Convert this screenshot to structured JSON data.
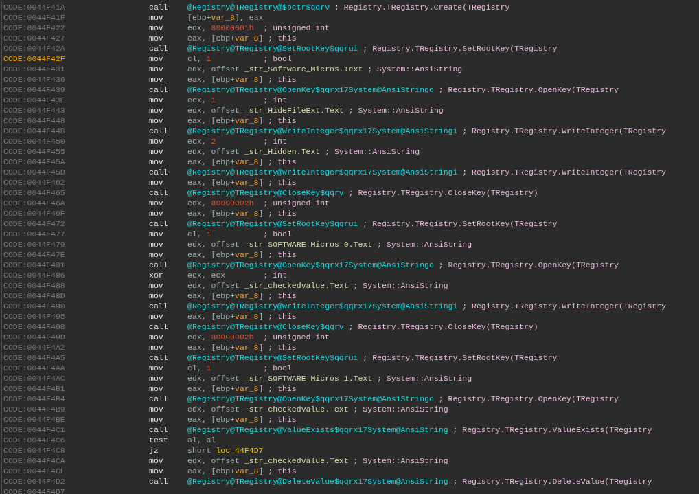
{
  "listing": [
    {
      "address": "CODE:0044F41A",
      "selected": false,
      "mnemonic": "call",
      "operands": [
        {
          "kind": "sym",
          "text": "@Registry@TRegistry@$bctr$qqrv"
        }
      ],
      "comment": "; Registry.TRegistry.Create(TRegistry"
    },
    {
      "address": "CODE:0044F41F",
      "selected": false,
      "mnemonic": "mov",
      "operands": [
        {
          "kind": "plain",
          "text": "[ebp+"
        },
        {
          "kind": "var",
          "text": "var_8"
        },
        {
          "kind": "plain",
          "text": "], eax"
        }
      ]
    },
    {
      "address": "CODE:0044F422",
      "selected": false,
      "mnemonic": "mov",
      "operands": [
        {
          "kind": "plain",
          "text": "edx, "
        },
        {
          "kind": "num",
          "text": "80000001h"
        }
      ],
      "comment": "; unsigned int"
    },
    {
      "address": "CODE:0044F427",
      "selected": false,
      "mnemonic": "mov",
      "operands": [
        {
          "kind": "plain",
          "text": "eax, [ebp+"
        },
        {
          "kind": "var",
          "text": "var_8"
        },
        {
          "kind": "plain",
          "text": "]"
        }
      ],
      "comment": "; this"
    },
    {
      "address": "CODE:0044F42A",
      "selected": false,
      "mnemonic": "call",
      "operands": [
        {
          "kind": "sym",
          "text": "@Registry@TRegistry@SetRootKey$qqrui"
        }
      ],
      "comment": "; Registry.TRegistry.SetRootKey(TRegistry"
    },
    {
      "address": "CODE:0044F42F",
      "selected": true,
      "mnemonic": "mov",
      "operands": [
        {
          "kind": "plain",
          "text": "cl, "
        },
        {
          "kind": "num",
          "text": "1"
        }
      ],
      "comment": "; bool"
    },
    {
      "address": "CODE:0044F431",
      "selected": false,
      "mnemonic": "mov",
      "operands": [
        {
          "kind": "plain",
          "text": "edx, offset "
        },
        {
          "kind": "str",
          "text": "_str_Software_Micros.Text"
        }
      ],
      "comment": "; System::AnsiString"
    },
    {
      "address": "CODE:0044F436",
      "selected": false,
      "mnemonic": "mov",
      "operands": [
        {
          "kind": "plain",
          "text": "eax, [ebp+"
        },
        {
          "kind": "var",
          "text": "var_8"
        },
        {
          "kind": "plain",
          "text": "]"
        }
      ],
      "comment": "; this"
    },
    {
      "address": "CODE:0044F439",
      "selected": false,
      "mnemonic": "call",
      "operands": [
        {
          "kind": "sym",
          "text": "@Registry@TRegistry@OpenKey$qqrx17System@AnsiStringo"
        }
      ],
      "comment": "; Registry.TRegistry.OpenKey(TRegistry"
    },
    {
      "address": "CODE:0044F43E",
      "selected": false,
      "mnemonic": "mov",
      "operands": [
        {
          "kind": "plain",
          "text": "ecx, "
        },
        {
          "kind": "num",
          "text": "1"
        }
      ],
      "comment": "; int"
    },
    {
      "address": "CODE:0044F443",
      "selected": false,
      "mnemonic": "mov",
      "operands": [
        {
          "kind": "plain",
          "text": "edx, offset "
        },
        {
          "kind": "str",
          "text": "_str_HideFileExt.Text"
        }
      ],
      "comment": "; System::AnsiString"
    },
    {
      "address": "CODE:0044F448",
      "selected": false,
      "mnemonic": "mov",
      "operands": [
        {
          "kind": "plain",
          "text": "eax, [ebp+"
        },
        {
          "kind": "var",
          "text": "var_8"
        },
        {
          "kind": "plain",
          "text": "]"
        }
      ],
      "comment": "; this"
    },
    {
      "address": "CODE:0044F44B",
      "selected": false,
      "mnemonic": "call",
      "operands": [
        {
          "kind": "sym",
          "text": "@Registry@TRegistry@WriteInteger$qqrx17System@AnsiStringi"
        }
      ],
      "comment": "; Registry.TRegistry.WriteInteger(TRegistry"
    },
    {
      "address": "CODE:0044F450",
      "selected": false,
      "mnemonic": "mov",
      "operands": [
        {
          "kind": "plain",
          "text": "ecx, "
        },
        {
          "kind": "num",
          "text": "2"
        }
      ],
      "comment": "; int"
    },
    {
      "address": "CODE:0044F455",
      "selected": false,
      "mnemonic": "mov",
      "operands": [
        {
          "kind": "plain",
          "text": "edx, offset "
        },
        {
          "kind": "str",
          "text": "_str_Hidden.Text"
        }
      ],
      "comment": "; System::AnsiString"
    },
    {
      "address": "CODE:0044F45A",
      "selected": false,
      "mnemonic": "mov",
      "operands": [
        {
          "kind": "plain",
          "text": "eax, [ebp+"
        },
        {
          "kind": "var",
          "text": "var_8"
        },
        {
          "kind": "plain",
          "text": "]"
        }
      ],
      "comment": "; this"
    },
    {
      "address": "CODE:0044F45D",
      "selected": false,
      "mnemonic": "call",
      "operands": [
        {
          "kind": "sym",
          "text": "@Registry@TRegistry@WriteInteger$qqrx17System@AnsiStringi"
        }
      ],
      "comment": "; Registry.TRegistry.WriteInteger(TRegistry"
    },
    {
      "address": "CODE:0044F462",
      "selected": false,
      "mnemonic": "mov",
      "operands": [
        {
          "kind": "plain",
          "text": "eax, [ebp+"
        },
        {
          "kind": "var",
          "text": "var_8"
        },
        {
          "kind": "plain",
          "text": "]"
        }
      ],
      "comment": "; this"
    },
    {
      "address": "CODE:0044F465",
      "selected": false,
      "mnemonic": "call",
      "operands": [
        {
          "kind": "sym",
          "text": "@Registry@TRegistry@CloseKey$qqrv"
        }
      ],
      "comment": "; Registry.TRegistry.CloseKey(TRegistry)"
    },
    {
      "address": "CODE:0044F46A",
      "selected": false,
      "mnemonic": "mov",
      "operands": [
        {
          "kind": "plain",
          "text": "edx, "
        },
        {
          "kind": "num",
          "text": "80000002h"
        }
      ],
      "comment": "; unsigned int"
    },
    {
      "address": "CODE:0044F46F",
      "selected": false,
      "mnemonic": "mov",
      "operands": [
        {
          "kind": "plain",
          "text": "eax, [ebp+"
        },
        {
          "kind": "var",
          "text": "var_8"
        },
        {
          "kind": "plain",
          "text": "]"
        }
      ],
      "comment": "; this"
    },
    {
      "address": "CODE:0044F472",
      "selected": false,
      "mnemonic": "call",
      "operands": [
        {
          "kind": "sym",
          "text": "@Registry@TRegistry@SetRootKey$qqrui"
        }
      ],
      "comment": "; Registry.TRegistry.SetRootKey(TRegistry"
    },
    {
      "address": "CODE:0044F477",
      "selected": false,
      "mnemonic": "mov",
      "operands": [
        {
          "kind": "plain",
          "text": "cl, "
        },
        {
          "kind": "num",
          "text": "1"
        }
      ],
      "comment": "; bool"
    },
    {
      "address": "CODE:0044F479",
      "selected": false,
      "mnemonic": "mov",
      "operands": [
        {
          "kind": "plain",
          "text": "edx, offset "
        },
        {
          "kind": "str",
          "text": "_str_SOFTWARE_Micros_0.Text"
        }
      ],
      "comment": "; System::AnsiString"
    },
    {
      "address": "CODE:0044F47E",
      "selected": false,
      "mnemonic": "mov",
      "operands": [
        {
          "kind": "plain",
          "text": "eax, [ebp+"
        },
        {
          "kind": "var",
          "text": "var_8"
        },
        {
          "kind": "plain",
          "text": "]"
        }
      ],
      "comment": "; this"
    },
    {
      "address": "CODE:0044F481",
      "selected": false,
      "mnemonic": "call",
      "operands": [
        {
          "kind": "sym",
          "text": "@Registry@TRegistry@OpenKey$qqrx17System@AnsiStringo"
        }
      ],
      "comment": "; Registry.TRegistry.OpenKey(TRegistry"
    },
    {
      "address": "CODE:0044F486",
      "selected": false,
      "mnemonic": "xor",
      "operands": [
        {
          "kind": "plain",
          "text": "ecx, ecx"
        }
      ],
      "comment": "; int"
    },
    {
      "address": "CODE:0044F488",
      "selected": false,
      "mnemonic": "mov",
      "operands": [
        {
          "kind": "plain",
          "text": "edx, offset "
        },
        {
          "kind": "str",
          "text": "_str_checkedvalue.Text"
        }
      ],
      "comment": "; System::AnsiString"
    },
    {
      "address": "CODE:0044F48D",
      "selected": false,
      "mnemonic": "mov",
      "operands": [
        {
          "kind": "plain",
          "text": "eax, [ebp+"
        },
        {
          "kind": "var",
          "text": "var_8"
        },
        {
          "kind": "plain",
          "text": "]"
        }
      ],
      "comment": "; this"
    },
    {
      "address": "CODE:0044F490",
      "selected": false,
      "mnemonic": "call",
      "operands": [
        {
          "kind": "sym",
          "text": "@Registry@TRegistry@WriteInteger$qqrx17System@AnsiStringi"
        }
      ],
      "comment": "; Registry.TRegistry.WriteInteger(TRegistry"
    },
    {
      "address": "CODE:0044F495",
      "selected": false,
      "mnemonic": "mov",
      "operands": [
        {
          "kind": "plain",
          "text": "eax, [ebp+"
        },
        {
          "kind": "var",
          "text": "var_8"
        },
        {
          "kind": "plain",
          "text": "]"
        }
      ],
      "comment": "; this"
    },
    {
      "address": "CODE:0044F498",
      "selected": false,
      "mnemonic": "call",
      "operands": [
        {
          "kind": "sym",
          "text": "@Registry@TRegistry@CloseKey$qqrv"
        }
      ],
      "comment": "; Registry.TRegistry.CloseKey(TRegistry)"
    },
    {
      "address": "CODE:0044F49D",
      "selected": false,
      "mnemonic": "mov",
      "operands": [
        {
          "kind": "plain",
          "text": "edx, "
        },
        {
          "kind": "num",
          "text": "80000002h"
        }
      ],
      "comment": "; unsigned int"
    },
    {
      "address": "CODE:0044F4A2",
      "selected": false,
      "mnemonic": "mov",
      "operands": [
        {
          "kind": "plain",
          "text": "eax, [ebp+"
        },
        {
          "kind": "var",
          "text": "var_8"
        },
        {
          "kind": "plain",
          "text": "]"
        }
      ],
      "comment": "; this"
    },
    {
      "address": "CODE:0044F4A5",
      "selected": false,
      "mnemonic": "call",
      "operands": [
        {
          "kind": "sym",
          "text": "@Registry@TRegistry@SetRootKey$qqrui"
        }
      ],
      "comment": "; Registry.TRegistry.SetRootKey(TRegistry"
    },
    {
      "address": "CODE:0044F4AA",
      "selected": false,
      "mnemonic": "mov",
      "operands": [
        {
          "kind": "plain",
          "text": "cl, "
        },
        {
          "kind": "num",
          "text": "1"
        }
      ],
      "comment": "; bool"
    },
    {
      "address": "CODE:0044F4AC",
      "selected": false,
      "mnemonic": "mov",
      "operands": [
        {
          "kind": "plain",
          "text": "edx, offset "
        },
        {
          "kind": "str",
          "text": "_str_SOFTWARE_Micros_1.Text"
        }
      ],
      "comment": "; System::AnsiString"
    },
    {
      "address": "CODE:0044F4B1",
      "selected": false,
      "mnemonic": "mov",
      "operands": [
        {
          "kind": "plain",
          "text": "eax, [ebp+"
        },
        {
          "kind": "var",
          "text": "var_8"
        },
        {
          "kind": "plain",
          "text": "]"
        }
      ],
      "comment": "; this"
    },
    {
      "address": "CODE:0044F4B4",
      "selected": false,
      "mnemonic": "call",
      "operands": [
        {
          "kind": "sym",
          "text": "@Registry@TRegistry@OpenKey$qqrx17System@AnsiStringo"
        }
      ],
      "comment": "; Registry.TRegistry.OpenKey(TRegistry"
    },
    {
      "address": "CODE:0044F4B9",
      "selected": false,
      "mnemonic": "mov",
      "operands": [
        {
          "kind": "plain",
          "text": "edx, offset "
        },
        {
          "kind": "str",
          "text": "_str_checkedvalue.Text"
        }
      ],
      "comment": "; System::AnsiString"
    },
    {
      "address": "CODE:0044F4BE",
      "selected": false,
      "mnemonic": "mov",
      "operands": [
        {
          "kind": "plain",
          "text": "eax, [ebp+"
        },
        {
          "kind": "var",
          "text": "var_8"
        },
        {
          "kind": "plain",
          "text": "]"
        }
      ],
      "comment": "; this"
    },
    {
      "address": "CODE:0044F4C1",
      "selected": false,
      "mnemonic": "call",
      "operands": [
        {
          "kind": "sym",
          "text": "@Registry@TRegistry@ValueExists$qqrx17System@AnsiString"
        }
      ],
      "comment": "; Registry.TRegistry.ValueExists(TRegistry"
    },
    {
      "address": "CODE:0044F4C6",
      "selected": false,
      "mnemonic": "test",
      "operands": [
        {
          "kind": "plain",
          "text": "al, al"
        }
      ]
    },
    {
      "address": "CODE:0044F4C8",
      "selected": false,
      "mnemonic": "jz",
      "operands": [
        {
          "kind": "plain",
          "text": "short "
        },
        {
          "kind": "loc",
          "text": "loc_44F4D7"
        }
      ]
    },
    {
      "address": "CODE:0044F4CA",
      "selected": false,
      "mnemonic": "mov",
      "operands": [
        {
          "kind": "plain",
          "text": "edx, offset "
        },
        {
          "kind": "str",
          "text": "_str_checkedvalue.Text"
        }
      ],
      "comment": "; System::AnsiString"
    },
    {
      "address": "CODE:0044F4CF",
      "selected": false,
      "mnemonic": "mov",
      "operands": [
        {
          "kind": "plain",
          "text": "eax, [ebp+"
        },
        {
          "kind": "var",
          "text": "var_8"
        },
        {
          "kind": "plain",
          "text": "]"
        }
      ],
      "comment": "; this"
    },
    {
      "address": "CODE:0044F4D2",
      "selected": false,
      "mnemonic": "call",
      "operands": [
        {
          "kind": "sym",
          "text": "@Registry@TRegistry@DeleteValue$qqrx17System@AnsiString"
        }
      ],
      "comment": "; Registry.TRegistry.DeleteValue(TRegistry"
    },
    {
      "address": "CODE:0044F4D7",
      "selected": false
    }
  ]
}
